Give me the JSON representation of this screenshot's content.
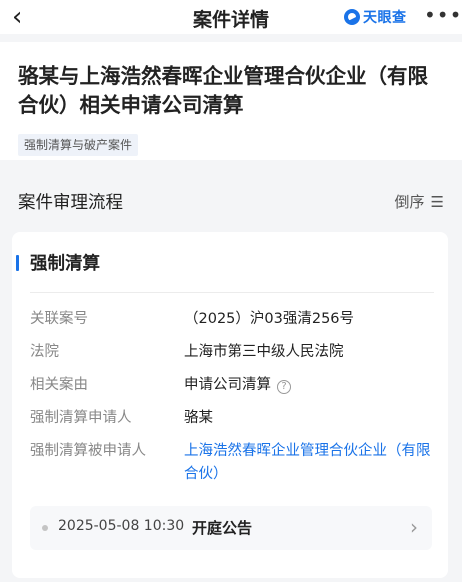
{
  "nav": {
    "title": "案件详情",
    "brand": "天眼查",
    "back_glyph": "‹",
    "more_glyph": "•••",
    "back_icon": "chevron-left-icon",
    "more_icon": "more-dots-icon",
    "brand_icon": "tianyancha-logo",
    "brand_color": "#1a73e8"
  },
  "case": {
    "title": "骆某与上海浩然春晖企业管理合伙企业（有限合伙）相关申请公司清算",
    "tag": "强制清算与破产案件"
  },
  "section": {
    "label": "案件审理流程",
    "sort_label": "倒序",
    "sort_glyph": "☰",
    "sort_icon": "sort-icon"
  },
  "card": {
    "title": "强制清算",
    "accent_color": "#1a73e8",
    "fields": [
      {
        "label": "关联案号",
        "value": "（2025）沪03强清256号"
      },
      {
        "label": "法院",
        "value": "上海市第三中级人民法院"
      },
      {
        "label": "相关案由",
        "value": "申请公司清算",
        "help_glyph": "?"
      },
      {
        "label": "强制清算申请人",
        "value": "骆某"
      },
      {
        "label": "强制清算被申请人",
        "value": "上海浩然春晖企业管理合伙企业（有限合伙）"
      }
    ],
    "event": {
      "date": "2025-05-08 10:30",
      "name": "开庭公告",
      "chevron_glyph": "›",
      "chevron_icon": "chevron-right-icon"
    }
  }
}
